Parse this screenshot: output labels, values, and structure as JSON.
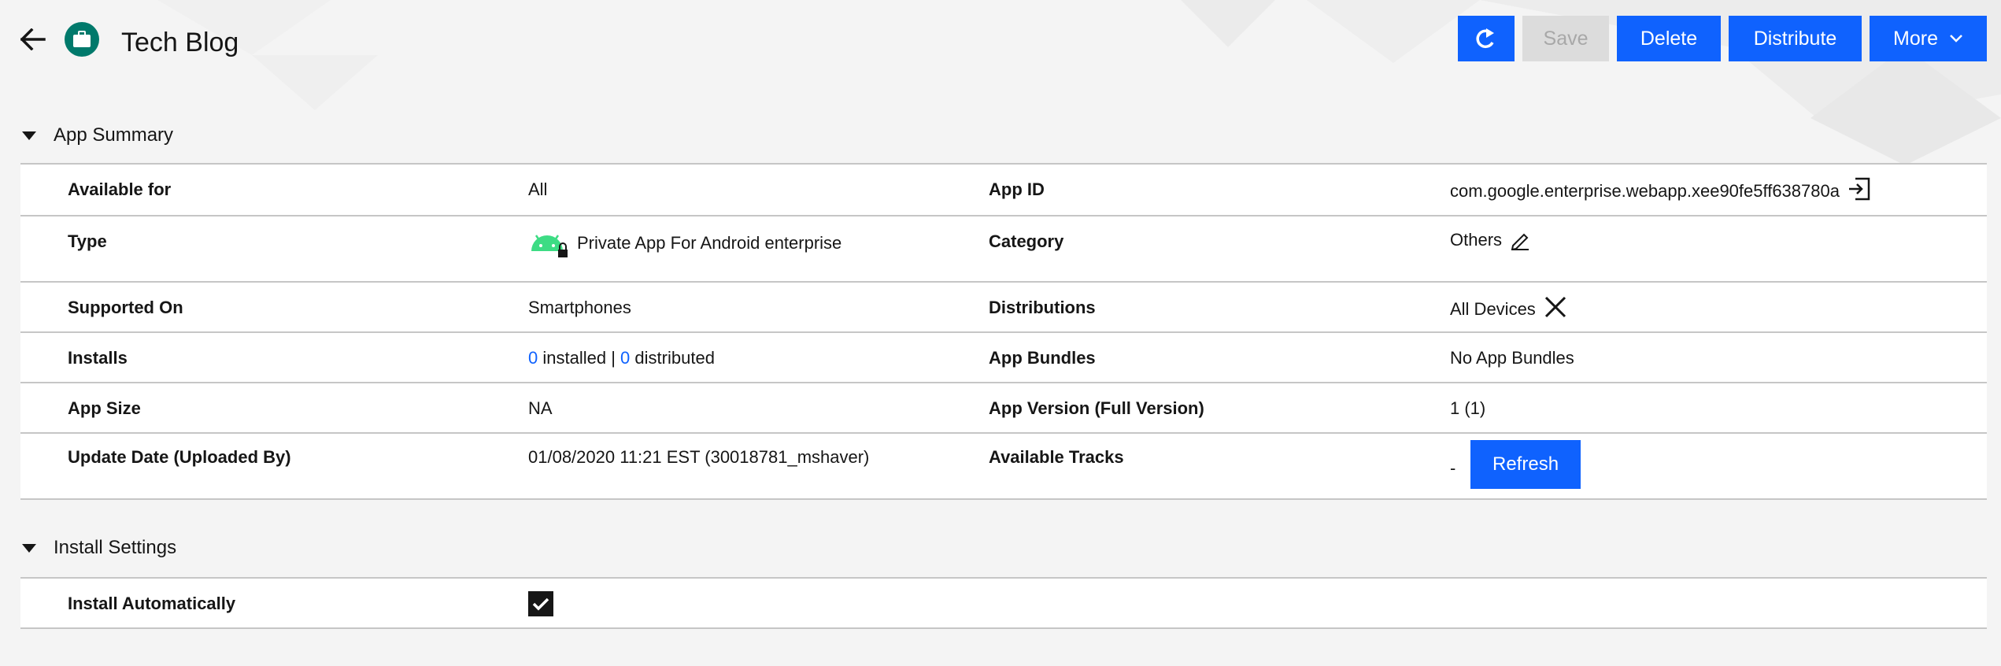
{
  "header": {
    "title": "Tech Blog",
    "back_icon": "arrow-left-icon",
    "app_icon": "briefcase-icon"
  },
  "toolbar": {
    "refresh_icon": "refresh-icon",
    "save_label": "Save",
    "delete_label": "Delete",
    "distribute_label": "Distribute",
    "more_label": "More"
  },
  "app_summary": {
    "title": "App Summary",
    "rows": [
      {
        "left_label": "Available for",
        "left_value": "All",
        "right_label": "App ID",
        "right_value": "com.google.enterprise.webapp.xee90fe5ff638780a"
      },
      {
        "left_label": "Type",
        "left_value": "Private App For Android enterprise",
        "right_label": "Category",
        "right_value": "Others"
      },
      {
        "left_label": "Supported On",
        "left_value": "Smartphones",
        "right_label": "Distributions",
        "right_value": "All Devices"
      },
      {
        "left_label": "Installs",
        "left_installed_count": "0",
        "left_installed_text": "installed |",
        "left_distributed_count": "0",
        "left_distributed_text": "distributed",
        "right_label": "App Bundles",
        "right_value": "No App Bundles"
      },
      {
        "left_label": "App Size",
        "left_value": "NA",
        "right_label": "App Version (Full Version)",
        "right_value": "1 (1)"
      },
      {
        "left_label": "Update Date (Uploaded By)",
        "left_value": "01/08/2020 11:21 EST (30018781_mshaver)",
        "right_label": "Available Tracks",
        "right_value": "-",
        "refresh_label": "Refresh"
      }
    ]
  },
  "install_settings": {
    "title": "Install Settings",
    "install_auto_label": "Install Automatically",
    "install_auto_checked": true
  },
  "colors": {
    "primary": "#0f62fe",
    "app_icon_bg": "#00796b",
    "android_green": "#3ddc84"
  }
}
